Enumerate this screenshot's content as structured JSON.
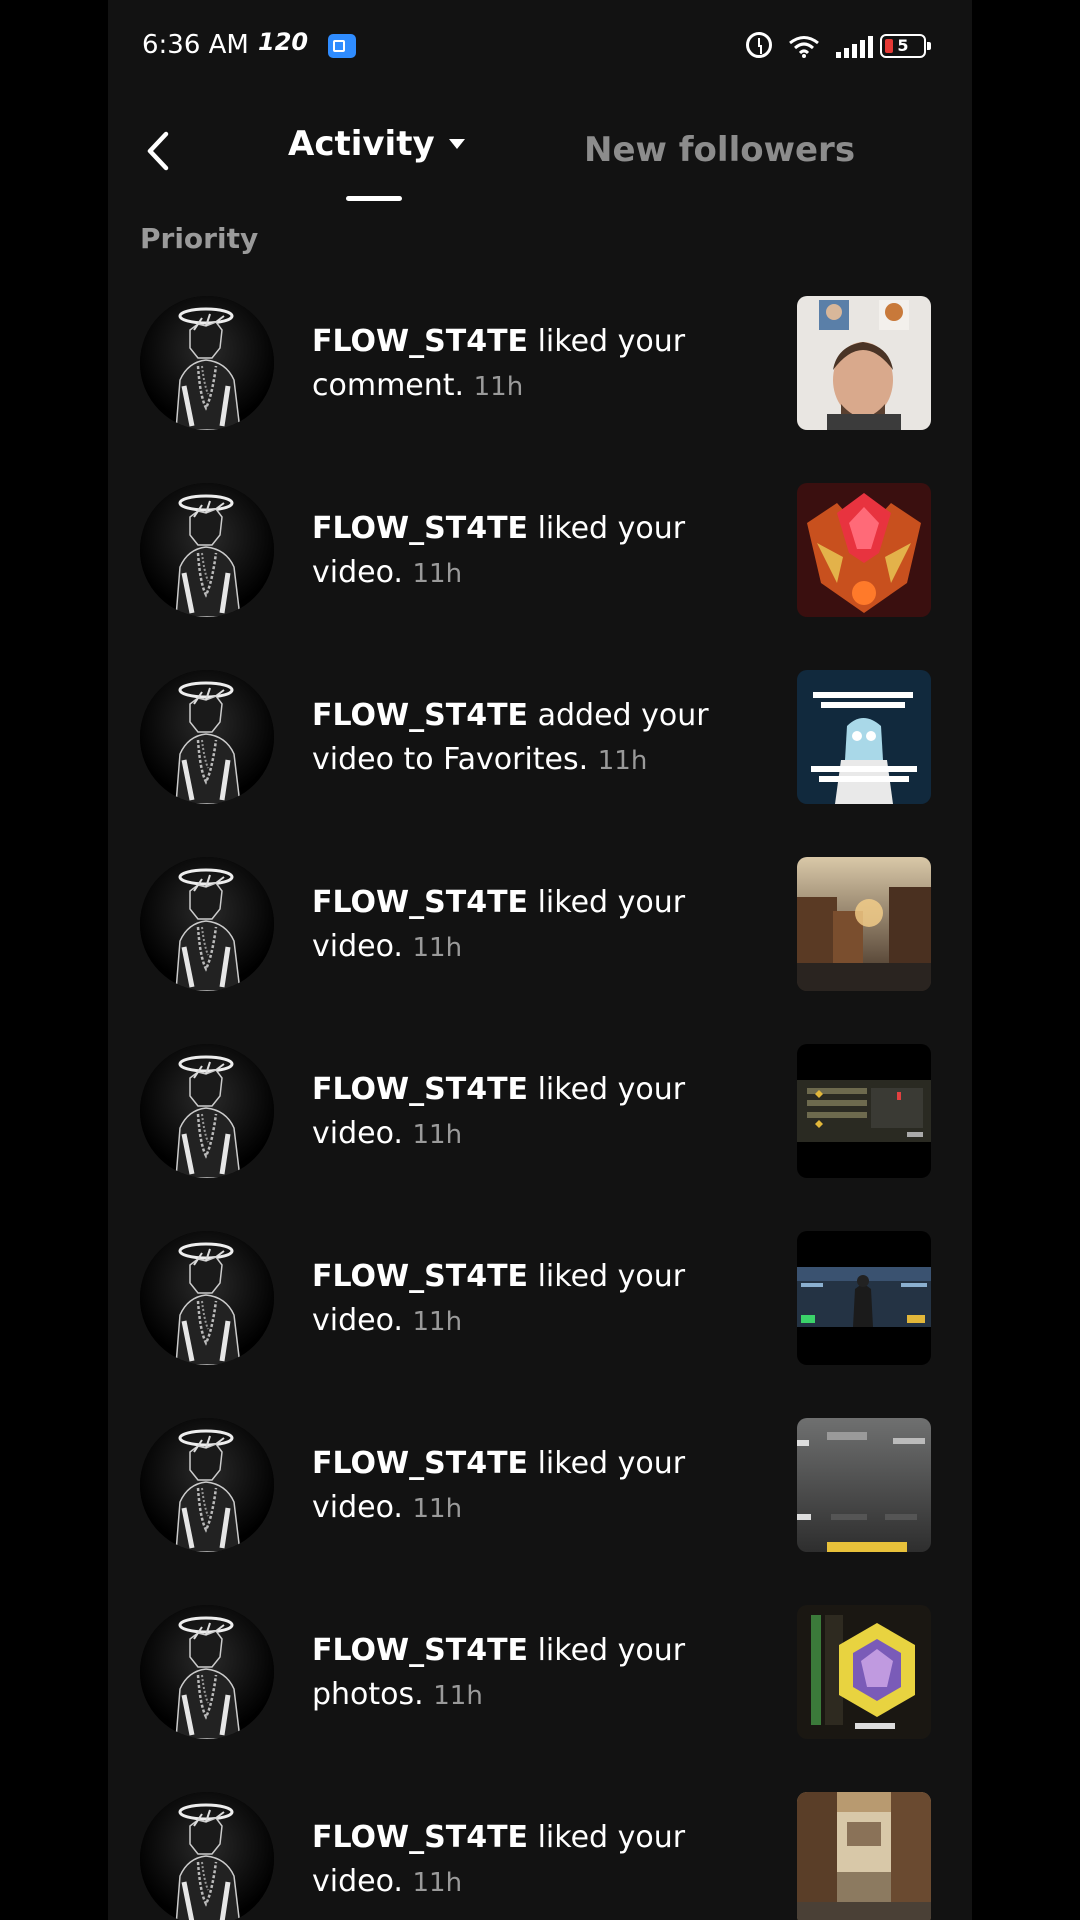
{
  "status_bar": {
    "time": "6:36 AM",
    "refresh_rate": "120",
    "battery_level": "5"
  },
  "header": {
    "tab_activity": "Activity",
    "tab_new_followers": "New followers"
  },
  "section": {
    "label": "Priority"
  },
  "notifications": [
    {
      "user": "FLOW_ST4TE",
      "action": "liked your comment.",
      "time": "11h",
      "thumb": "thumb-face"
    },
    {
      "user": "FLOW_ST4TE",
      "action": "liked your video.",
      "time": "11h",
      "thumb": "thumb-helmet"
    },
    {
      "user": "FLOW_ST4TE",
      "action": "added your video to Favorites.",
      "time": "11h",
      "thumb": "thumb-meme"
    },
    {
      "user": "FLOW_ST4TE",
      "action": "liked your video.",
      "time": "11h",
      "thumb": "thumb-city"
    },
    {
      "user": "FLOW_ST4TE",
      "action": "liked your video.",
      "time": "11h",
      "thumb": "thumb-menu"
    },
    {
      "user": "FLOW_ST4TE",
      "action": "liked your video.",
      "time": "11h",
      "thumb": "thumb-game"
    },
    {
      "user": "FLOW_ST4TE",
      "action": "liked your video.",
      "time": "11h",
      "thumb": "thumb-grey"
    },
    {
      "user": "FLOW_ST4TE",
      "action": "liked your photos.",
      "time": "11h",
      "thumb": "thumb-gold"
    },
    {
      "user": "FLOW_ST4TE",
      "action": "liked your video.",
      "time": "11h",
      "thumb": "thumb-street"
    }
  ],
  "colors": {
    "background": "#121212",
    "secondary_text": "#9a9a9a",
    "accent_blue": "#2f8cff",
    "battery_low": "#e53935"
  }
}
